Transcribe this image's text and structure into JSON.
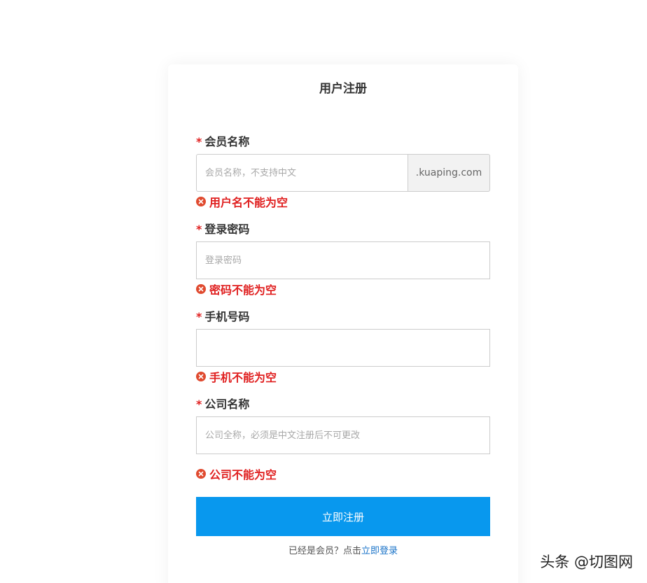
{
  "form": {
    "title": "用户注册",
    "required_mark": "*",
    "fields": [
      {
        "label": "会员名称",
        "value": "",
        "placeholder": "会员名称，不支持中文",
        "suffix": ".kuaping.com",
        "error": "用户名不能为空"
      },
      {
        "label": "登录密码",
        "value": "",
        "placeholder": "登录密码",
        "error": "密码不能为空"
      },
      {
        "label": "手机号码",
        "value": "",
        "placeholder": "",
        "error": "手机不能为空"
      },
      {
        "label": "公司名称",
        "value": "",
        "placeholder": "公司全称，必须是中文注册后不可更改",
        "error": "公司不能为空"
      }
    ],
    "submit_label": "立即注册",
    "login_prompt": "已经是会员？点击",
    "login_link": "立即登录"
  },
  "watermark": "头条 @切图网",
  "colors": {
    "error": "#e02020",
    "primary": "#0898ee",
    "link": "#1a73c8"
  },
  "icons": {
    "error": "error-circle-x-icon"
  }
}
